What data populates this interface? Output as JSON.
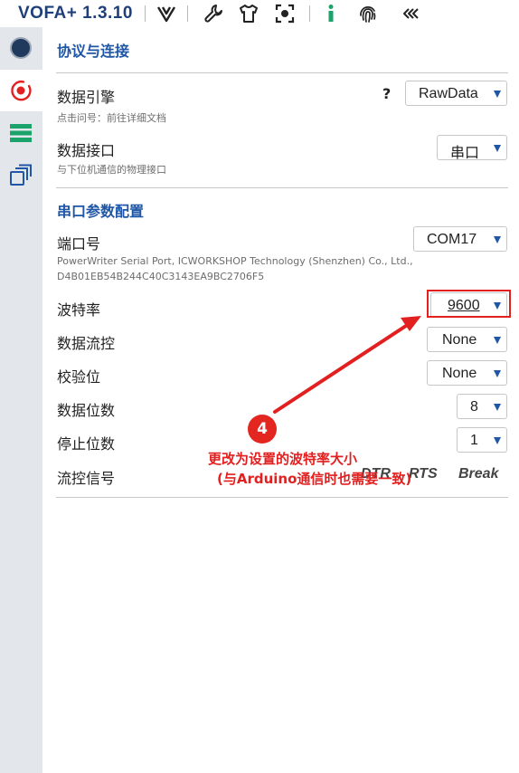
{
  "app": {
    "title": "VOFA+ 1.3.10"
  },
  "section_protocol": {
    "title": "协议与连接",
    "engine": {
      "label": "数据引擎",
      "help": "?",
      "desc": "点击问号：前往详细文档",
      "value": "RawData"
    },
    "interface": {
      "label": "数据接口",
      "desc": "与下位机通信的物理接口",
      "value": "串口"
    }
  },
  "section_serial": {
    "title": "串口参数配置",
    "port": {
      "label": "端口号",
      "value": "COM17",
      "desc_line1": "PowerWriter Serial Port, ICWORKSHOP Technology (Shenzhen) Co., Ltd.,",
      "desc_line2": "D4B01EB54B244C40C3143EA9BC2706F5"
    },
    "baud": {
      "label": "波特率",
      "value": "9600"
    },
    "flow_control": {
      "label": "数据流控",
      "value": "None"
    },
    "parity": {
      "label": "校验位",
      "value": "None"
    },
    "data_bits": {
      "label": "数据位数",
      "value": "8"
    },
    "stop_bits": {
      "label": "停止位数",
      "value": "1"
    },
    "flow_signals": {
      "label": "流控信号",
      "dtr": "DTR",
      "rts": "RTS",
      "brk": "Break"
    }
  },
  "annotation": {
    "step": "4",
    "line1": "更改为设置的波特率大小",
    "line2": "(与Arduino通信时也需要一致)",
    "color": "#e22020"
  },
  "colors": {
    "accent": "#1f56a5",
    "sidebar": "#e3e6ea"
  }
}
